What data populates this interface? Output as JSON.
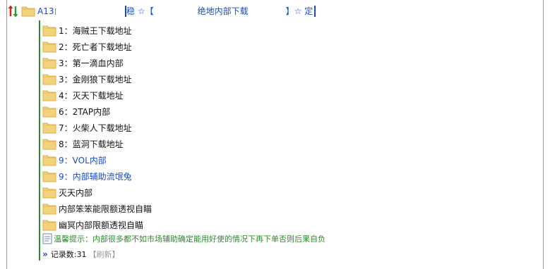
{
  "root": {
    "label": "A13",
    "title_parts": {
      "left": "稳 ☆【",
      "middle": "绝地内部下载",
      "right": "】☆ 定"
    }
  },
  "folders": [
    {
      "label": "1：海贼王下载地址",
      "style": "black"
    },
    {
      "label": "2：死亡者下载地址",
      "style": "black"
    },
    {
      "label": "3：第一滴血内部",
      "style": "black"
    },
    {
      "label": "3：金刚狼下载地址",
      "style": "black"
    },
    {
      "label": "4：灭天下载地址",
      "style": "black"
    },
    {
      "label": "6：2TAP内部",
      "style": "black"
    },
    {
      "label": "7：火柴人下载地址",
      "style": "black"
    },
    {
      "label": "8：蓝洞下载地址",
      "style": "black"
    },
    {
      "label": "9：VOL内部",
      "style": "blue"
    },
    {
      "label": "9：内部辅助流氓兔",
      "style": "blue"
    },
    {
      "label": "灭天内部",
      "style": "black"
    },
    {
      "label": "内部笨笨能限额透视自瞄",
      "style": "black"
    },
    {
      "label": "幽冥内部限额透视自瞄",
      "style": "black"
    }
  ],
  "notice": {
    "text": "温馨提示：内部很多都不如市场辅助确定能用好使的情况下再下单否则后果自负"
  },
  "records": {
    "chevron": "»",
    "label": "记录数:31",
    "refresh": "【刷新】"
  },
  "colors": {
    "link_blue": "#1a4ac8",
    "tree_green": "#2e8b2e",
    "folder_yellow": "#f2d27a"
  }
}
